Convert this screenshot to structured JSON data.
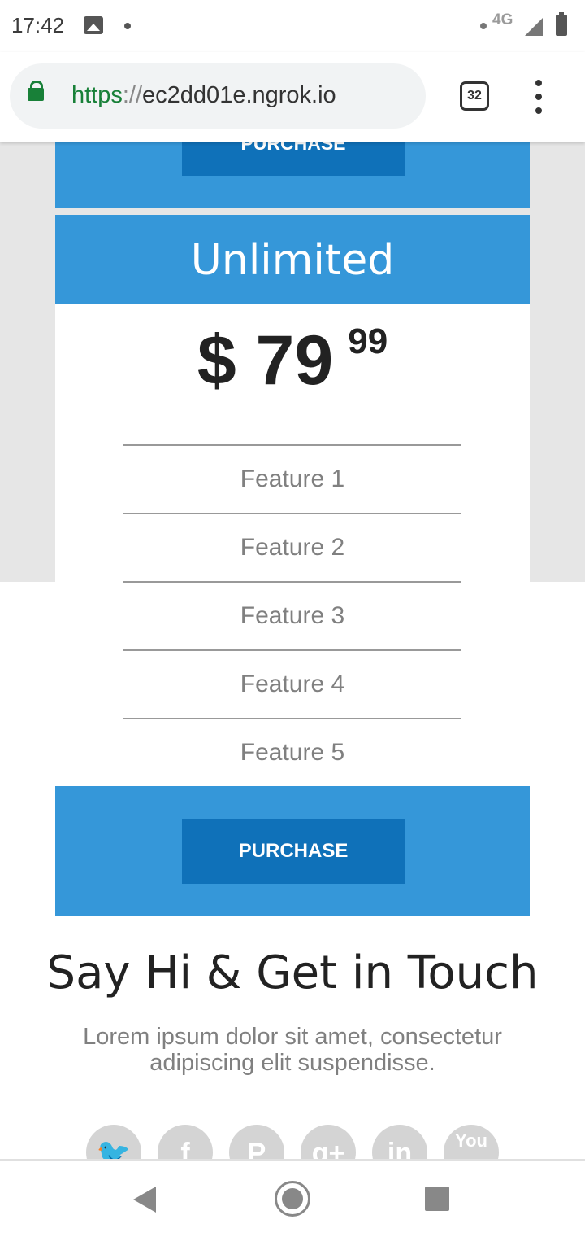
{
  "status_bar": {
    "time": "17:42",
    "network": "4G",
    "icons": [
      "image-icon",
      "notification-dot-icon",
      "signal-icon",
      "battery-icon"
    ]
  },
  "browser": {
    "url_scheme": "https",
    "url_sep": "://",
    "url_host": "ec2dd01e.ngrok.io",
    "tab_count": "32"
  },
  "previous_plan": {
    "purchase_label": "PURCHASE"
  },
  "plan": {
    "title": "Unlimited",
    "price_main": "$ 79",
    "price_cents": "99",
    "features": [
      "Feature 1",
      "Feature 2",
      "Feature 3",
      "Feature 4",
      "Feature 5"
    ],
    "purchase_label": "PURCHASE",
    "accent_color": "#3597d9",
    "button_color": "#0f71b9"
  },
  "contact": {
    "title": "Say Hi & Get in Touch",
    "text": "Lorem ipsum dolor sit amet, consectetur adipiscing elit suspendisse."
  },
  "social": {
    "twitter": "🐦",
    "facebook": "f",
    "pinterest": "P",
    "google": "g+",
    "linkedin": "in",
    "youtube": "You"
  }
}
